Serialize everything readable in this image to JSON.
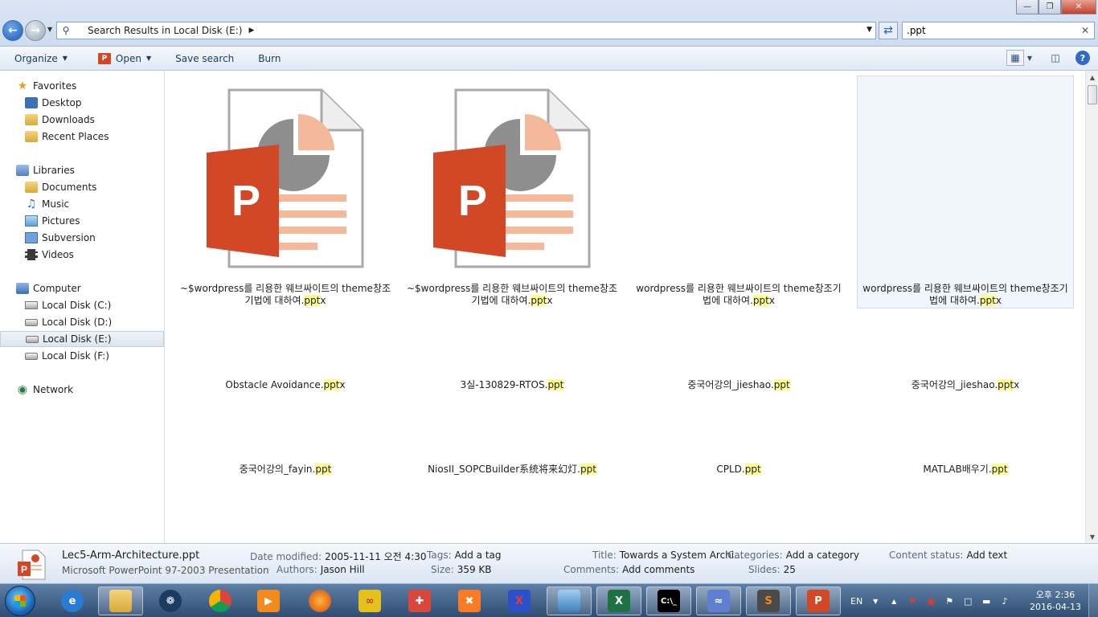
{
  "address": {
    "path": "Search Results in Local Disk (E:)",
    "search_value": ".ppt"
  },
  "toolbar": {
    "organize": "Organize",
    "open": "Open",
    "save_search": "Save search",
    "burn": "Burn"
  },
  "sidebar": {
    "favorites": "Favorites",
    "fav_items": [
      "Desktop",
      "Downloads",
      "Recent Places"
    ],
    "libraries": "Libraries",
    "lib_items": [
      "Documents",
      "Music",
      "Pictures",
      "Subversion",
      "Videos"
    ],
    "computer": "Computer",
    "drives": [
      "Local Disk (C:)",
      "Local Disk (D:)",
      "Local Disk (E:)",
      "Local Disk (F:)"
    ],
    "network": "Network"
  },
  "files": [
    {
      "name_line1": "~$wordpress를 리용한 웨브싸이트의 theme창조",
      "name_line2": "기법에 대하여.",
      "ext": "ppt",
      "ext_tail": "x"
    },
    {
      "name_line1": "~$wordpress를 리용한 웨브싸이트의 theme창조",
      "name_line2": "기법에 대하여.",
      "ext": "ppt",
      "ext_tail": "x"
    },
    {
      "name_line1": "wordpress를 리용한 웨브싸이트의 theme창조기",
      "name_line2": "법에 대하여.",
      "ext": "ppt",
      "ext_tail": "x"
    },
    {
      "name_line1": "wordpress를 리용한 웨브싸이트의 theme창조기",
      "name_line2": "법에 대하여.",
      "ext": "ppt",
      "ext_tail": "x"
    },
    {
      "name": "Obstacle Avoidance.",
      "ext": "ppt",
      "ext_tail": "x"
    },
    {
      "name": "3실-130829-RTOS.",
      "ext": "ppt",
      "ext_tail": ""
    },
    {
      "name": "중국어강의_jieshao.",
      "ext": "ppt",
      "ext_tail": ""
    },
    {
      "name": "중국어강의_jieshao.",
      "ext": "ppt",
      "ext_tail": "x"
    },
    {
      "name": "중국어강의_fayin.",
      "ext": "ppt",
      "ext_tail": ""
    },
    {
      "name": "NiosII_SOPCBuilder系统将来幻灯.",
      "ext": "ppt",
      "ext_tail": ""
    },
    {
      "name": "CPLD.",
      "ext": "ppt",
      "ext_tail": ""
    },
    {
      "name": "MATLAB배우기.",
      "ext": "ppt",
      "ext_tail": ""
    }
  ],
  "details": {
    "filename": "Lec5-Arm-Architecture.ppt",
    "filetype": "Microsoft PowerPoint 97-2003 Presentation",
    "date_modified_label": "Date modified:",
    "date_modified": "2005-11-11 오전 4:30",
    "authors_label": "Authors:",
    "authors": "Jason Hill",
    "tags_label": "Tags:",
    "tags": "Add a tag",
    "size_label": "Size:",
    "size": "359 KB",
    "title_label": "Title:",
    "title": "Towards a System Archi...",
    "comments_label": "Comments:",
    "comments": "Add comments",
    "categories_label": "Categories:",
    "categories": "Add a category",
    "slides_label": "Slides:",
    "slides": "25",
    "content_status_label": "Content status:",
    "content_status": "Add text"
  },
  "taskbar": {
    "lang": "EN",
    "time": "오후 2:36",
    "date": "2016-04-13"
  },
  "colors": {
    "ppt_orange": "#d24726",
    "ppt_light": "#f4b89a",
    "highlight": "#ffff8f",
    "selection": "#f1f6fc"
  }
}
